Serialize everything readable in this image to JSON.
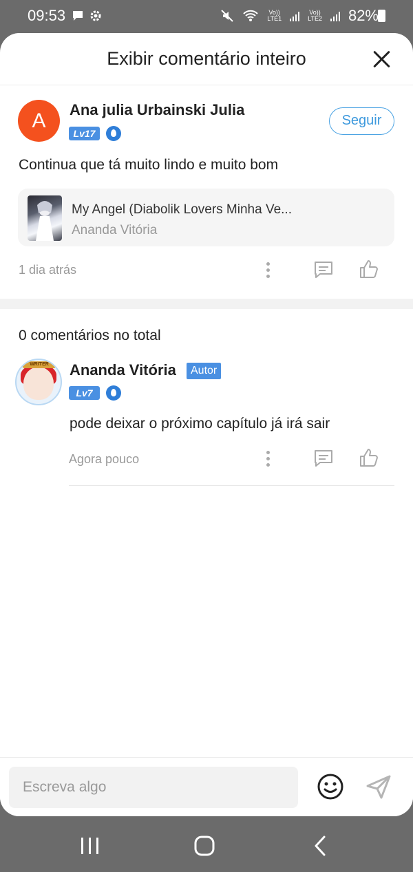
{
  "status_bar": {
    "time": "09:53",
    "lte1": "LTE1",
    "lte2": "LTE2",
    "volte": "Vo))",
    "battery": "82%"
  },
  "header": {
    "title": "Exibir comentário inteiro",
    "close_icon": "close-icon"
  },
  "main_comment": {
    "avatar_letter": "A",
    "avatar_color": "#f4511e",
    "user_name": "Ana julia Urbainski Julia",
    "level": "Lv17",
    "follow_label": "Seguir",
    "text": "Continua que tá muito lindo e muito bom",
    "book": {
      "title": "My Angel (Diabolik Lovers Minha Ve...",
      "author": "Ananda Vitória"
    },
    "time": "1 dia atrás"
  },
  "replies": {
    "total_label": "0 comentários no total",
    "items": [
      {
        "user_name": "Ananda Vitória",
        "author_tag": "Autor",
        "level": "Lv7",
        "avatar_banner": "WRITER",
        "text": "pode deixar o próximo capítulo já irá sair",
        "time": "Agora pouco"
      }
    ]
  },
  "composer": {
    "placeholder": "Escreva algo",
    "emoji_icon": "emoji-icon",
    "send_icon": "send-icon"
  },
  "colors": {
    "accent": "#4a90e2",
    "follow": "#3d99dd",
    "muted": "#999999"
  }
}
